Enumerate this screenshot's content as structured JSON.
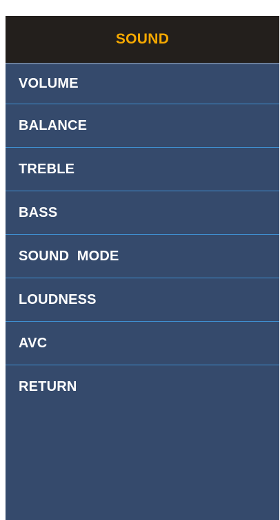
{
  "menu": {
    "title": "SOUND",
    "items": [
      {
        "label": "VOLUME"
      },
      {
        "label": "BALANCE"
      },
      {
        "label": "TREBLE"
      },
      {
        "label": "BASS"
      },
      {
        "label": "SOUND  MODE"
      },
      {
        "label": "LOUDNESS"
      },
      {
        "label": "AVC"
      },
      {
        "label": "RETURN"
      }
    ]
  },
  "colors": {
    "header_bg": "#231f1c",
    "title_accent": "#f5a800",
    "panel_bg": "#354a6c",
    "divider": "#3f8fd0",
    "item_text": "#ffffff"
  }
}
